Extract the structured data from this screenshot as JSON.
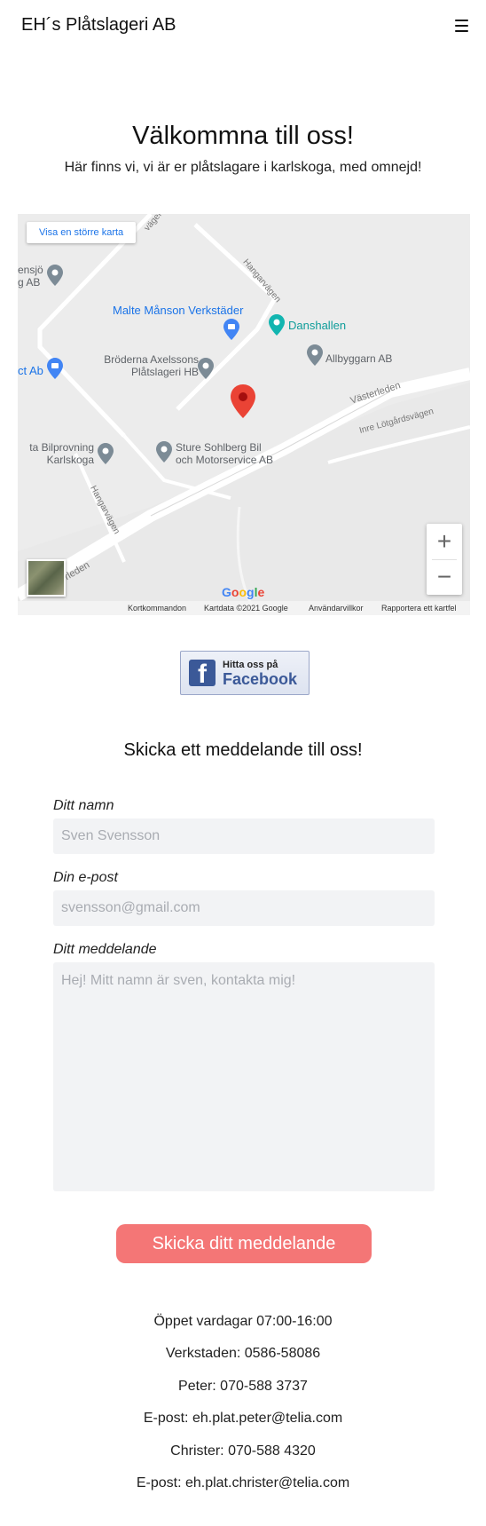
{
  "header": {
    "brand": "EH´s Plåtslageri AB",
    "menu_icon": "hamburger-menu-icon"
  },
  "hero": {
    "title": "Välkommna till oss!",
    "subtitle": "Här finns vi, vi är er plåtslagare i karlskoga, med omnejd!"
  },
  "map": {
    "view_larger": "Visa en större karta",
    "pois": {
      "malte": "Malte Månson Verkstäder",
      "danshallen": "Danshallen",
      "allbyggarn": "Allbyggarn AB",
      "broderna_1": "Bröderna Axelssons",
      "broderna_2": "Plåtslageri HB",
      "sture_1": "Sture Sohlberg Bil",
      "sture_2": "och Motorservice AB",
      "bilprovning_1": "ta Bilprovning",
      "bilprovning_2": "Karlskoga",
      "ensjo_1": "ensjö",
      "ensjo_2": "g AB",
      "ct_ab": "ct Ab"
    },
    "roads": {
      "hangarvagen_1": "Hangarvägen",
      "hangarvagen_2": "Hangarvägen",
      "vasterleden_1": "Västerleden",
      "vasterleden_2": "sterleden",
      "inre_lotgardsvagen": "Inre Lötgårdsvägen",
      "vagen_top": "vägen"
    },
    "zoom_in": "+",
    "zoom_out": "−",
    "google": [
      "G",
      "o",
      "o",
      "g",
      "l",
      "e"
    ],
    "attribution": {
      "shortcuts": "Kortkommandon",
      "data": "Kartdata ©2021 Google",
      "terms": "Användarvillkor",
      "report": "Rapportera ett kartfel"
    }
  },
  "facebook": {
    "small": "Hitta oss på",
    "big": "Facebook",
    "logo_letter": "f"
  },
  "form": {
    "title": "Skicka ett meddelande till oss!",
    "name_label": "Ditt namn",
    "name_placeholder": "Sven Svensson",
    "email_label": "Din e-post",
    "email_placeholder": "svensson@gmail.com",
    "message_label": "Ditt meddelande",
    "message_placeholder": "Hej! Mitt namn är sven, kontakta mig!",
    "submit": "Skicka ditt meddelande"
  },
  "contact": {
    "hours": "Öppet vardagar 07:00-16:00",
    "workshop": "Verkstaden: 0586-58086",
    "peter": "Peter: 070-588 3737",
    "peter_email": "E-post: eh.plat.peter@telia.com",
    "christer": "Christer: 070-588 4320",
    "christer_email": "E-post: eh.plat.christer@telia.com"
  },
  "colors": {
    "accent": "#f47676",
    "facebook": "#3b5998",
    "map_link": "#1a73e8",
    "pin": "#ea4335"
  }
}
